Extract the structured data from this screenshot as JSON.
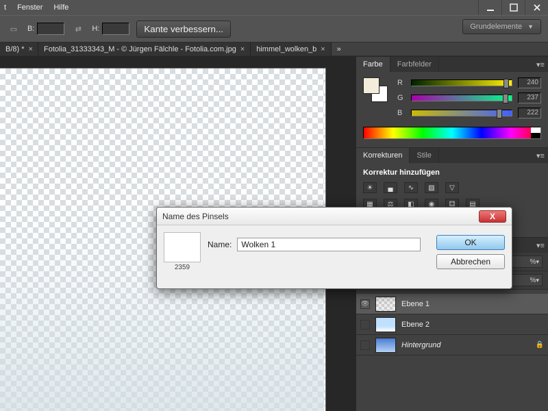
{
  "menu": {
    "items": [
      "t",
      "Fenster",
      "Hilfe"
    ]
  },
  "options": {
    "b_label": "B:",
    "b_value": "",
    "h_label": "H:",
    "h_value": "",
    "kante": "Kante verbessern...",
    "workspace": "Grundelemente"
  },
  "tabs": {
    "items": [
      {
        "label": "B/8) *"
      },
      {
        "label": "Fotolia_31333343_M - © Jürgen Fälchle - Fotolia.com.jpg"
      },
      {
        "label": "himmel_wolken_b"
      }
    ],
    "more": "»"
  },
  "farbe": {
    "panel_label": "Farbe",
    "panel2_label": "Farbfelder",
    "r_label": "R",
    "g_label": "G",
    "b_label": "B",
    "r_value": "240",
    "g_value": "237",
    "b_value": "222"
  },
  "korr": {
    "panel_label": "Korrekturen",
    "panel2_label": "Stile",
    "title": "Korrektur hinzufügen"
  },
  "layers": {
    "opacity": "% ",
    "items": [
      {
        "name": "Ebene 1",
        "visible": true,
        "thumb": "checker",
        "selected": true
      },
      {
        "name": "Ebene 2",
        "visible": false,
        "thumb": "sky",
        "selected": false
      },
      {
        "name": "Hintergrund",
        "visible": false,
        "thumb": "sky2",
        "italic": true,
        "locked": true
      }
    ]
  },
  "dialog": {
    "title": "Name des Pinsels",
    "name_label": "Name:",
    "name_value": "Wolken 1",
    "brush_num": "2359",
    "ok": "OK",
    "cancel": "Abbrechen"
  }
}
